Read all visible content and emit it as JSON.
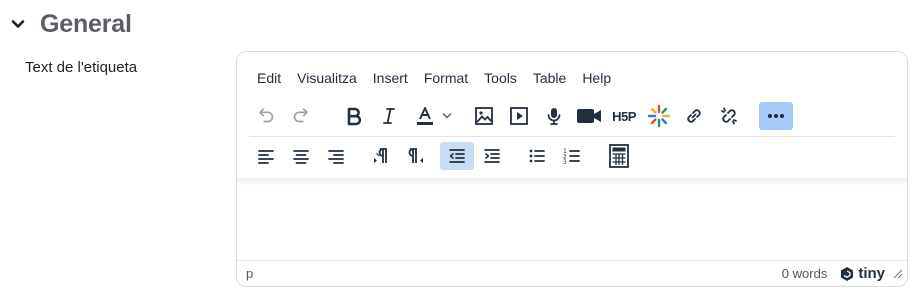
{
  "section": {
    "title": "General",
    "icon": "chevron-down-icon"
  },
  "field": {
    "label": "Text de l'etiqueta"
  },
  "editor": {
    "menubar": [
      "Edit",
      "Visualitza",
      "Insert",
      "Format",
      "Tools",
      "Table",
      "Help"
    ],
    "toolbar_row1": [
      {
        "name": "undo-icon",
        "state": "disabled"
      },
      {
        "name": "redo-icon",
        "state": "disabled"
      },
      {
        "name": "bold-icon"
      },
      {
        "name": "italic-icon"
      },
      {
        "name": "text-color-icon"
      },
      {
        "name": "image-icon"
      },
      {
        "name": "media-icon"
      },
      {
        "name": "microphone-icon"
      },
      {
        "name": "video-camera-icon"
      },
      {
        "name": "h5p-icon"
      },
      {
        "name": "sparkle-icon"
      },
      {
        "name": "link-icon"
      },
      {
        "name": "unlink-icon"
      },
      {
        "name": "more-icon",
        "state": "highlighted"
      }
    ],
    "toolbar_row2": [
      {
        "name": "align-left-icon"
      },
      {
        "name": "align-center-icon"
      },
      {
        "name": "align-right-icon"
      },
      {
        "name": "ltr-icon"
      },
      {
        "name": "rtl-icon"
      },
      {
        "name": "outdent-icon",
        "state": "active"
      },
      {
        "name": "indent-icon"
      },
      {
        "name": "bullet-list-icon"
      },
      {
        "name": "numbered-list-icon"
      },
      {
        "name": "calculator-icon"
      }
    ],
    "h5p_text": "H5P",
    "statusbar": {
      "path": "p",
      "word_count": "0 words",
      "brand": "tiny"
    },
    "colors": {
      "accent": "#a6c9f5",
      "active": "#c8dcf5",
      "icon": "#222f3e"
    }
  }
}
